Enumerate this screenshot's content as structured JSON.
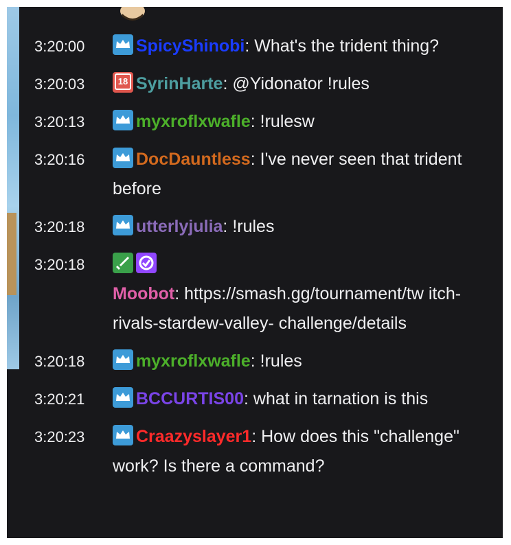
{
  "messages": [
    {
      "timestamp": "3:20:00",
      "badges": [
        "broadcaster-crown"
      ],
      "username": "SpicyShinobi",
      "user_color": "#1a3cff",
      "text": "What's the trident thing?"
    },
    {
      "timestamp": "3:20:03",
      "badges": [
        "age-18"
      ],
      "username": "SyrinHarte",
      "user_color": "#4d9ea0",
      "text": "@Yidonator !rules"
    },
    {
      "timestamp": "3:20:13",
      "badges": [
        "broadcaster-crown"
      ],
      "username": "myxroflxwafle",
      "user_color": "#4caf2a",
      "text": "!rulesw"
    },
    {
      "timestamp": "3:20:16",
      "badges": [
        "broadcaster-crown"
      ],
      "username": "DocDauntless",
      "user_color": "#d2691e",
      "text": "I've never seen that trident before"
    },
    {
      "timestamp": "3:20:18",
      "badges": [
        "broadcaster-crown"
      ],
      "username": "utterlyjulia",
      "user_color": "#8a6bb8",
      "text": "!rules"
    },
    {
      "timestamp": "3:20:18",
      "badges": [
        "moderator-sword",
        "verified-check"
      ],
      "username": "Moobot",
      "user_color": "#e05fa8",
      "text": "https://smash.gg/tournament/tw itch-rivals-stardew-valley- challenge/details"
    },
    {
      "timestamp": "3:20:18",
      "badges": [
        "broadcaster-crown"
      ],
      "username": "myxroflxwafle",
      "user_color": "#4caf2a",
      "text": "!rules"
    },
    {
      "timestamp": "3:20:21",
      "badges": [
        "broadcaster-crown"
      ],
      "username": "BCCURTIS00",
      "user_color": "#7a44e8",
      "text": "what in tarnation is this"
    },
    {
      "timestamp": "3:20:23",
      "badges": [
        "broadcaster-crown"
      ],
      "username": "Craazyslayer1",
      "user_color": "#ff2a2a",
      "text": "How does this \"challenge\" work? Is there a command?"
    }
  ],
  "colors": {
    "background": "#18181b",
    "text": "#efeff1",
    "crown_badge": "#3d9bd8"
  },
  "separator": ": "
}
